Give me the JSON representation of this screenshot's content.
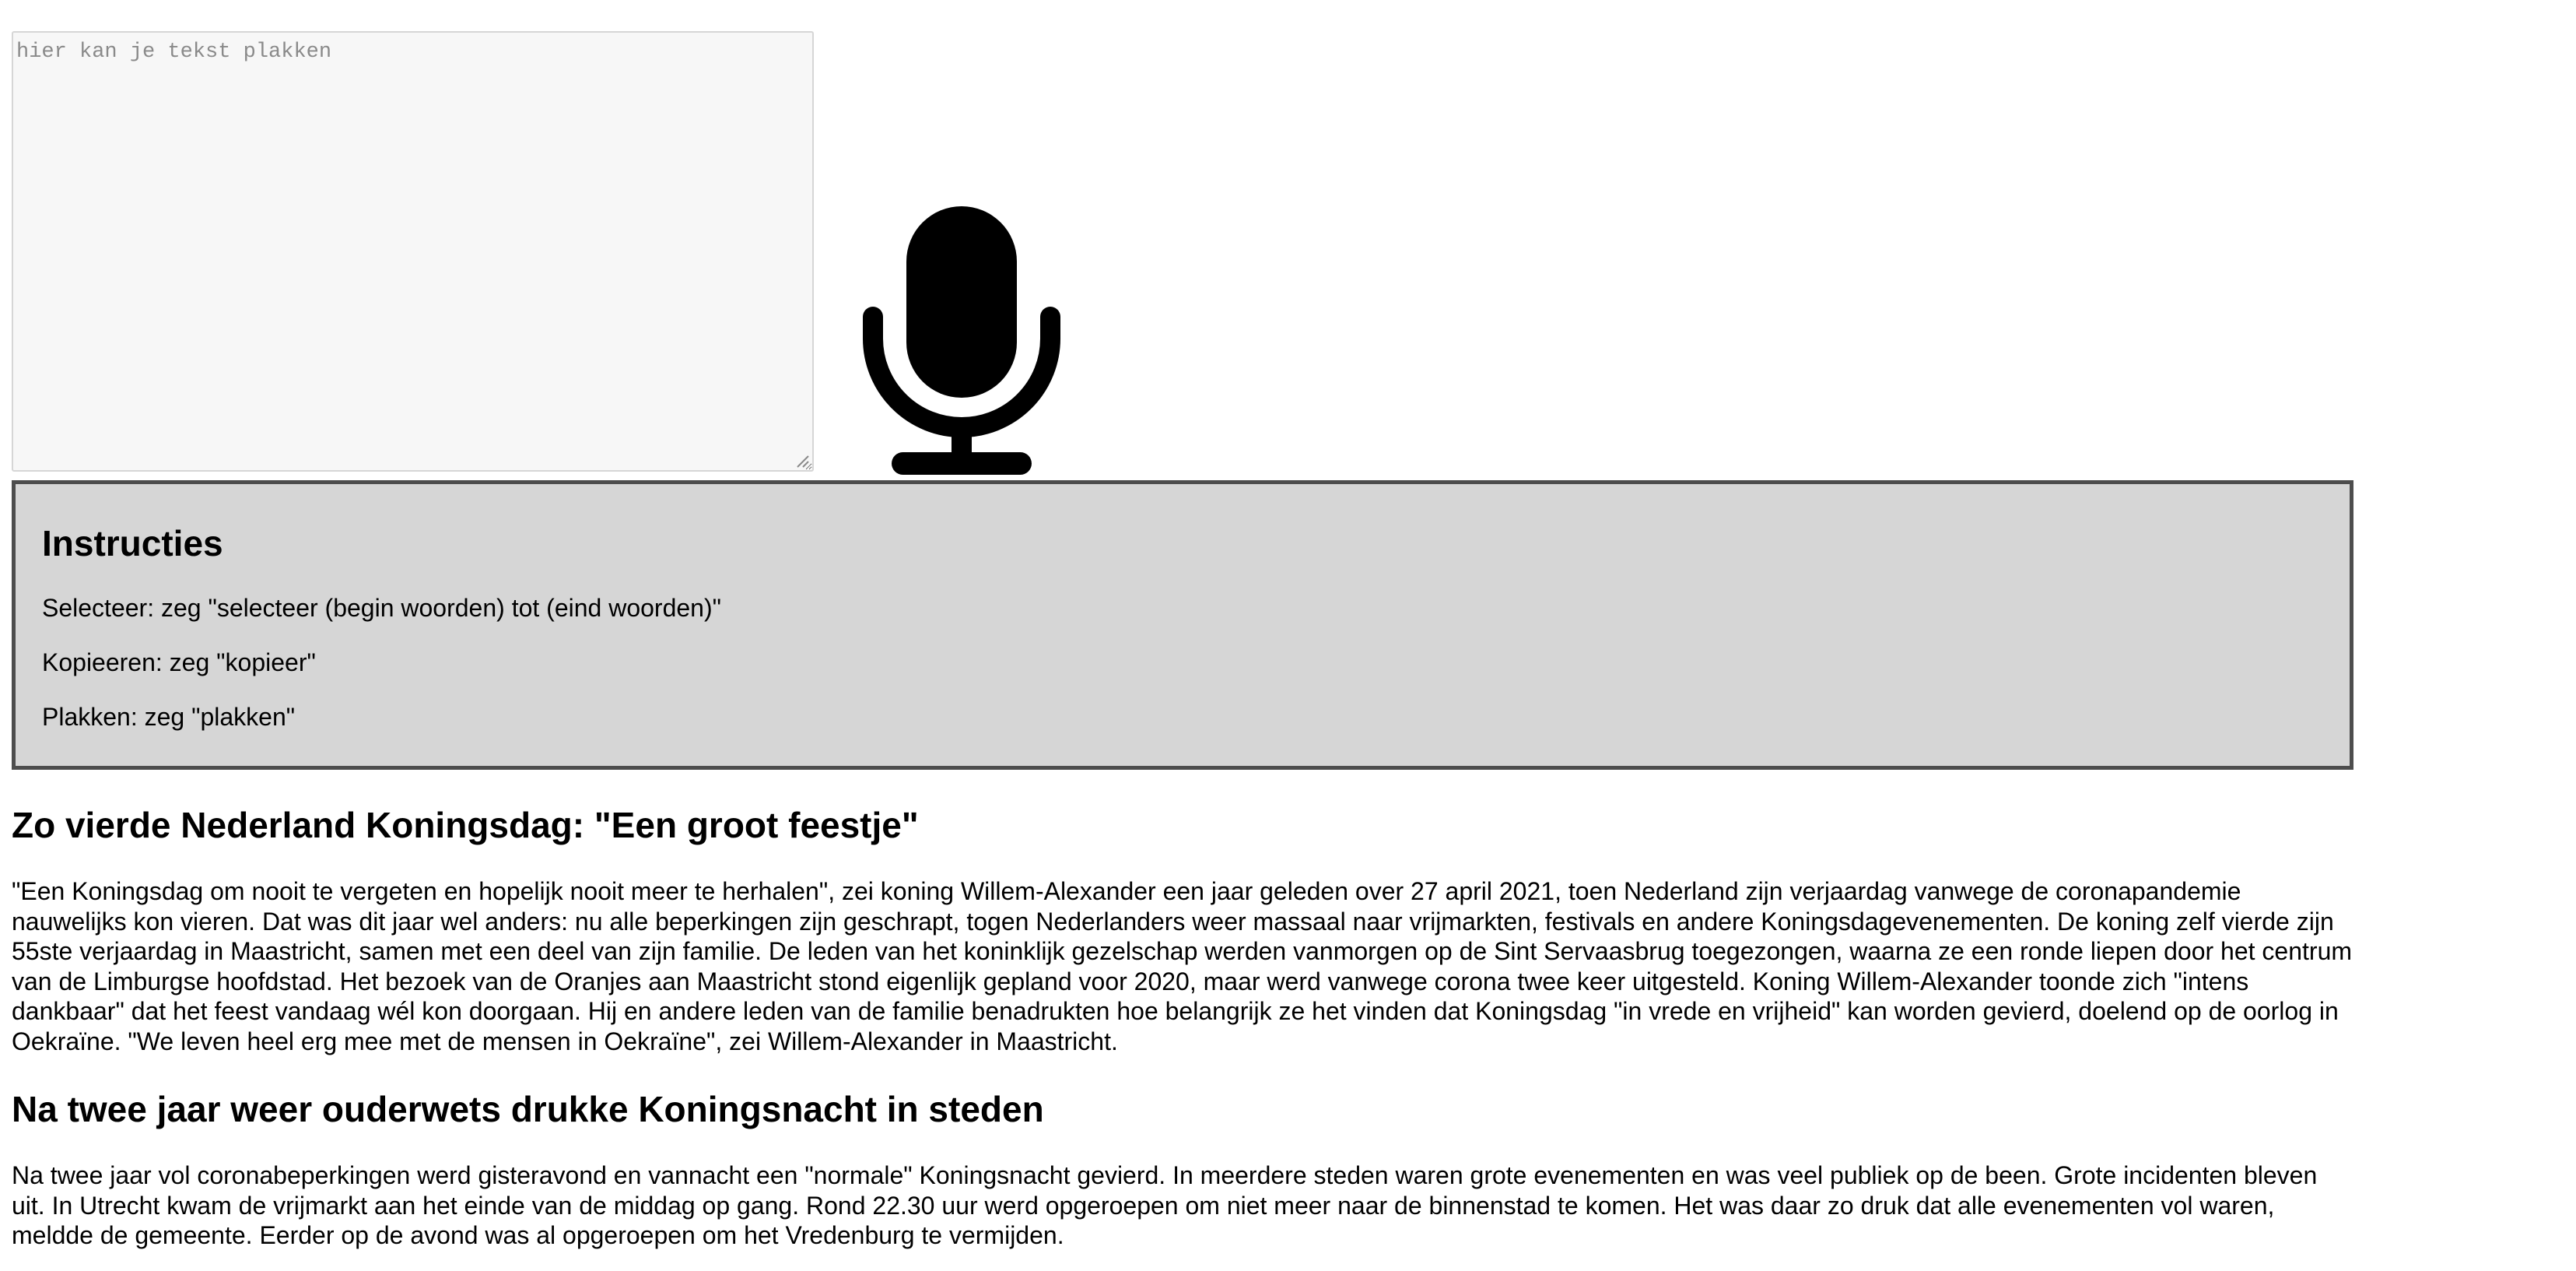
{
  "editor": {
    "placeholder": "hier kan je tekst plakken",
    "value": ""
  },
  "mic": {
    "icon": "microphone-icon",
    "color": "#000000"
  },
  "instructions": {
    "title": "Instructies",
    "items": [
      "Selecteer: zeg \"selecteer (begin woorden) tot (eind woorden)\"",
      "Kopieeren: zeg \"kopieer\"",
      "Plakken: zeg \"plakken\""
    ],
    "background": "#d6d6d6",
    "border": "#4d4d4d"
  },
  "article": {
    "sections": [
      {
        "heading": "Zo vierde Nederland Koningsdag: \"Een groot feestje\"",
        "body": "\"Een Koningsdag om nooit te vergeten en hopelijk nooit meer te herhalen\", zei koning Willem-Alexander een jaar geleden over 27 april 2021, toen Nederland zijn verjaardag vanwege de coronapandemie nauwelijks kon vieren. Dat was dit jaar wel anders: nu alle beperkingen zijn geschrapt, togen Nederlanders weer massaal naar vrijmarkten, festivals en andere Koningsdagevenementen. De koning zelf vierde zijn 55ste verjaardag in Maastricht, samen met een deel van zijn familie. De leden van het koninklijk gezelschap werden vanmorgen op de Sint Servaasbrug toegezongen, waarna ze een ronde liepen door het centrum van de Limburgse hoofdstad. Het bezoek van de Oranjes aan Maastricht stond eigenlijk gepland voor 2020, maar werd vanwege corona twee keer uitgesteld. Koning Willem-Alexander toonde zich \"intens dankbaar\" dat het feest vandaag wél kon doorgaan. Hij en andere leden van de familie benadrukten hoe belangrijk ze het vinden dat Koningsdag \"in vrede en vrijheid\" kan worden gevierd, doelend op de oorlog in Oekraïne. \"We leven heel erg mee met de mensen in Oekraïne\", zei Willem-Alexander in Maastricht."
      },
      {
        "heading": "Na twee jaar weer ouderwets drukke Koningsnacht in steden",
        "body": "Na twee jaar vol coronabeperkingen werd gisteravond en vannacht een \"normale\" Koningsnacht gevierd. In meerdere steden waren grote evenementen en was veel publiek op de been. Grote incidenten bleven uit. In Utrecht kwam de vrijmarkt aan het einde van de middag op gang. Rond 22.30 uur werd opgeroepen om niet meer naar de binnenstad te komen. Het was daar zo druk dat alle evenementen vol waren, meldde de gemeente. Eerder op de avond was al opgeroepen om het Vredenburg te vermijden."
      }
    ]
  }
}
